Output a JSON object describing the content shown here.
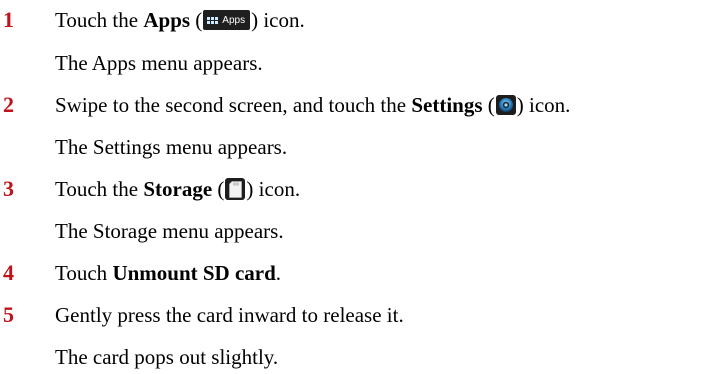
{
  "steps": [
    {
      "number": "1",
      "pre": "Touch the ",
      "bold": "Apps",
      "open": " (",
      "icon_label": "Apps",
      "close": ") icon.",
      "result": "The Apps menu appears."
    },
    {
      "number": "2",
      "pre": "Swipe to the second screen, and touch the ",
      "bold": "Settings",
      "open": " (",
      "close": ") icon.",
      "result": "The Settings menu appears."
    },
    {
      "number": "3",
      "pre": "Touch the ",
      "bold": "Storage",
      "open": " (",
      "close": ") icon.",
      "result": "The Storage menu appears."
    },
    {
      "number": "4",
      "pre": "Touch ",
      "bold": "Unmount SD card",
      "post": "."
    },
    {
      "number": "5",
      "text": "Gently press the card inward to release it.",
      "result": "The card pops out slightly."
    }
  ],
  "icons": {
    "apps": "apps-icon",
    "settings": "settings-icon",
    "storage": "sd-card-icon"
  },
  "colors": {
    "step_number": "#c0121b",
    "icon_bg": "#1d1d1d"
  }
}
